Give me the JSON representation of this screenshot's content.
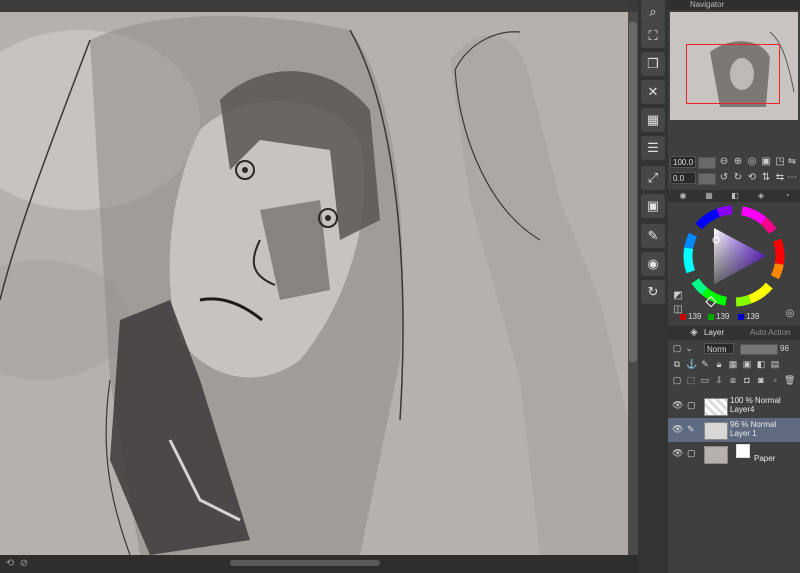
{
  "canvas": {
    "bg_color": "#b7b1ae"
  },
  "toolbar": {
    "icons": [
      "magnifier-icon",
      "zoom-fit-icon",
      "copy-icon",
      "close-x-icon",
      "grid-icon",
      "layer-list-icon",
      "transform-icon",
      "folder-icon",
      "edit-icon",
      "camera-icon",
      "refresh-icon"
    ]
  },
  "navigator": {
    "title": "Navigator",
    "zoom": "100.0",
    "rotation": "0.0"
  },
  "color": {
    "r": "139",
    "g": "139",
    "b": "139",
    "accent": "#ff2a2a"
  },
  "layer_panel": {
    "tab_layer": "Layer",
    "tab_auto_action": "Auto Action",
    "blend_mode": "Norm",
    "opacity": "96",
    "layers": [
      {
        "opacity_mode": "100 % Normal",
        "name": "Layer4"
      },
      {
        "opacity_mode": "96 % Normal",
        "name": "Layer 1"
      },
      {
        "name": "Paper"
      }
    ]
  }
}
